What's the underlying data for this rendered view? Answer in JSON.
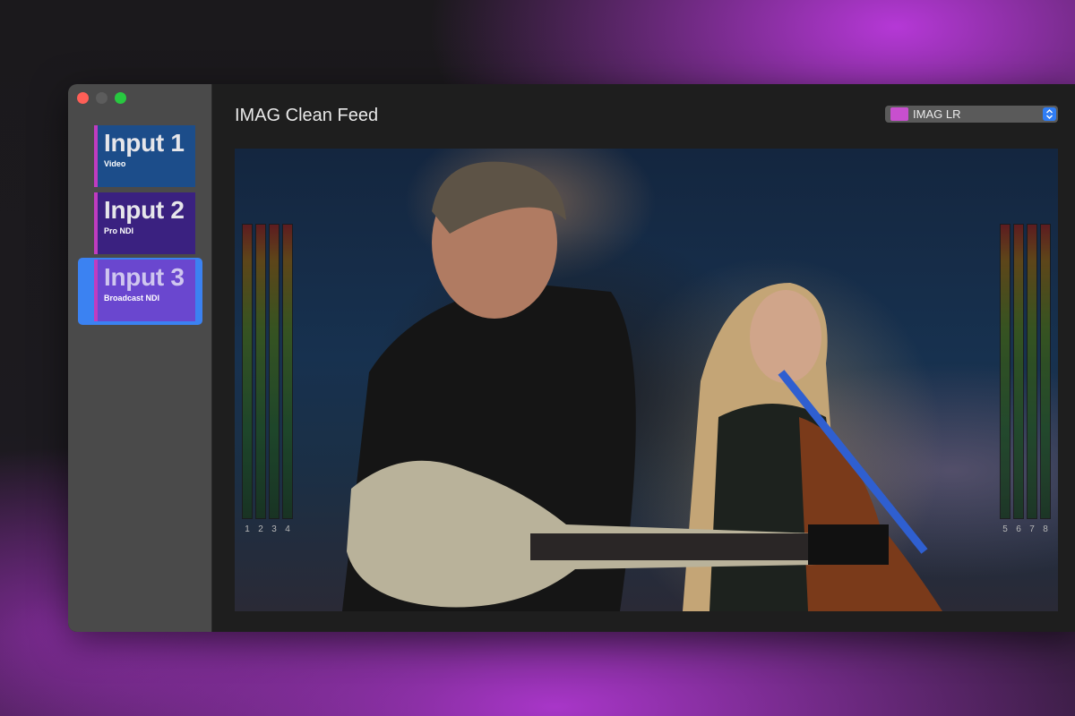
{
  "sidebar": {
    "inputs": [
      {
        "name": "Input 1",
        "type": "Video"
      },
      {
        "name": "Input 2",
        "type": "Pro NDI"
      },
      {
        "name": "Input 3",
        "type": "Broadcast NDI"
      }
    ],
    "selected_index": 2
  },
  "main": {
    "title": "IMAG Clean Feed",
    "output_selector": {
      "label": "IMAG LR",
      "color": "#c84fce"
    },
    "meters": {
      "left_channels": [
        "1",
        "2",
        "3",
        "4"
      ],
      "right_channels": [
        "5",
        "6",
        "7",
        "8"
      ]
    }
  },
  "colors": {
    "accent": "#3b82f2",
    "input_1": "#1c4d8a",
    "input_2": "#3a2180",
    "input_3": "#6a47cf",
    "card_stripe": "#c03cc0"
  }
}
